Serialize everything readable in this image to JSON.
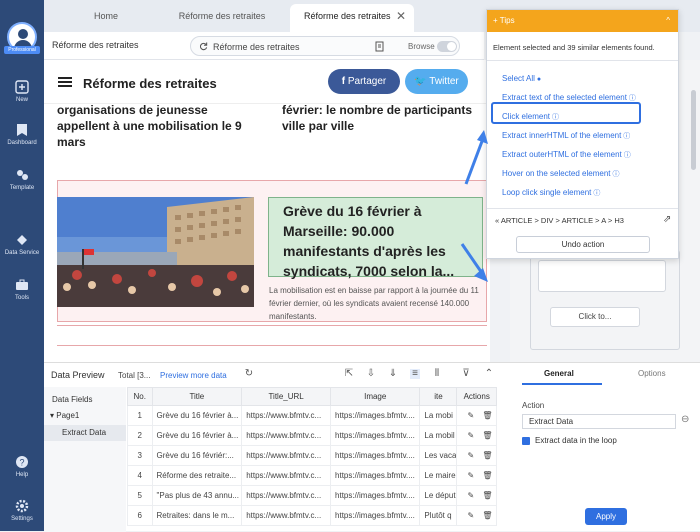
{
  "sidebar": {
    "avatar_tag": "Professional",
    "items": [
      {
        "label": "New",
        "icon": "plus-icon"
      },
      {
        "label": "Dashboard",
        "icon": "dashboard-icon"
      },
      {
        "label": "Template",
        "icon": "template-icon"
      },
      {
        "label": "Data Service",
        "icon": "cloud-icon"
      },
      {
        "label": "Tools",
        "icon": "toolbox-icon"
      },
      {
        "label": "Help",
        "icon": "question-icon"
      },
      {
        "label": "Settings",
        "icon": "gear-icon"
      }
    ]
  },
  "tabs": [
    {
      "label": "Home"
    },
    {
      "label": "Réforme des retraites"
    },
    {
      "label": "Réforme des retraites",
      "active": true
    }
  ],
  "address": {
    "title": "Réforme des retraites",
    "url": "Réforme des retraites",
    "browse_label": "Browse"
  },
  "page": {
    "title": "Réforme des retraites",
    "share_facebook": "Partager",
    "share_twitter": "Twitter",
    "headline_left": "organisations de jeunesse appellent à une mobilisation le 9 mars",
    "headline_right": "février: le nombre de participants ville par ville",
    "article_h3": "Grève du 16 février à Marseille: 90.000 manifestants d'après les syndicats, 7000 selon la...",
    "article_desc": "La mobilisation est en baisse par rapport à la journée du 11 février dernier, où les syndicats avaient recensé 140.000 manifestants."
  },
  "tips": {
    "header": "Tips",
    "message": "Element selected and 39 similar elements found.",
    "options": [
      "Select All",
      "Extract text of the selected element",
      "Click element",
      "Extract innerHTML of the element",
      "Extract outerHTML of the element",
      "Hover on the selected element",
      "Loop click single element"
    ],
    "breadcrumb": "ARTICLE > DIV > ARTICLE > A > H3",
    "undo_label": "Undo action"
  },
  "workflow": {
    "click_to_label": "Click to..."
  },
  "properties": {
    "tab_general": "General",
    "tab_options": "Options",
    "action_label": "Action",
    "action_value": "Extract Data",
    "loop_label": "Extract data in the loop",
    "apply_label": "Apply"
  },
  "preview": {
    "title": "Data Preview",
    "total": "Total [3...",
    "more_link": "Preview more data",
    "fields_header": "Data Fields",
    "page_label": "Page1",
    "extract_label": "Extract Data",
    "columns": [
      "No.",
      "Title",
      "Title_URL",
      "Image",
      "ite",
      "Actions"
    ],
    "rows": [
      [
        "1",
        "Grève du 16 février à...",
        "https://www.bfmtv.c...",
        "https://images.bfmtv....",
        "La mobi"
      ],
      [
        "2",
        "Grève du 16 février à...",
        "https://www.bfmtv.c...",
        "https://images.bfmtv....",
        "La mobil"
      ],
      [
        "3",
        "Grève du 16 févriér:...",
        "https://www.bfmtv.c...",
        "https://images.bfmtv....",
        "Les vaca"
      ],
      [
        "4",
        "Réforme des retraite...",
        "https://www.bfmtv.c...",
        "https://images.bfmtv....",
        "Le maire"
      ],
      [
        "5",
        "\"Pas plus de 43 annu...",
        "https://www.bfmtv.c...",
        "https://images.bfmtv....",
        "Le déput"
      ],
      [
        "6",
        "Retraites: dans le m...",
        "https://www.bfmtv.c...",
        "https://images.bfmtv....",
        "Plutôt q"
      ]
    ]
  },
  "colors": {
    "sidebar": "#2d4a78",
    "tips_header": "#f4a51c",
    "accent": "#2f6fe0",
    "facebook": "#3b5998",
    "twitter": "#55acee"
  }
}
